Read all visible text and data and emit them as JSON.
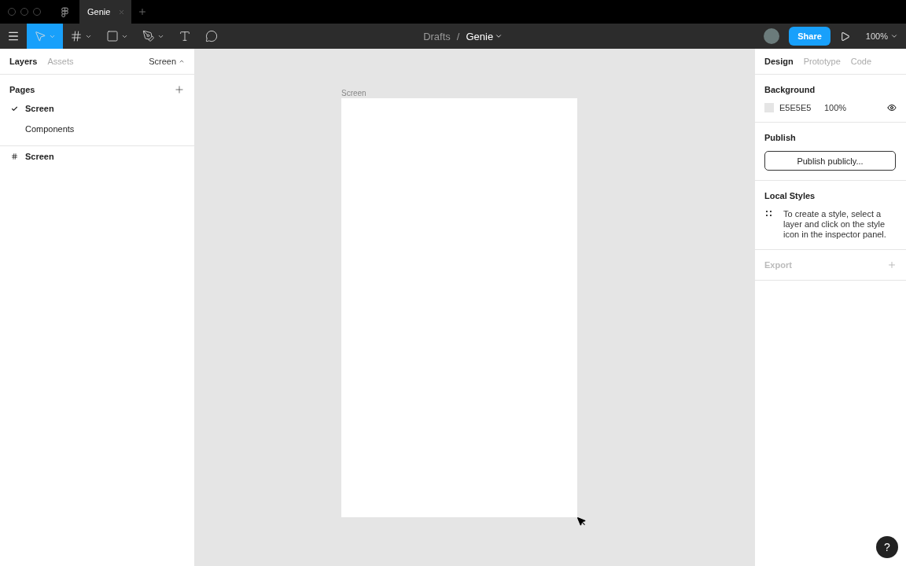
{
  "window": {
    "tabs": [
      {
        "label": "Genie",
        "selected": true
      }
    ]
  },
  "toolbar": {
    "tools": [
      {
        "kind": "move",
        "selected": true,
        "dropdown": true
      },
      {
        "kind": "frame",
        "selected": false,
        "dropdown": true
      },
      {
        "kind": "shape",
        "selected": false,
        "dropdown": true
      },
      {
        "kind": "pen",
        "selected": false,
        "dropdown": true
      },
      {
        "kind": "text",
        "selected": false,
        "dropdown": false
      },
      {
        "kind": "comment",
        "selected": false,
        "dropdown": false
      }
    ],
    "breadcrumb": {
      "folder": "Drafts",
      "separator": "/",
      "file": "Genie"
    },
    "share": "Share",
    "zoom": "100%"
  },
  "left_panel": {
    "tabs": [
      {
        "label": "Layers",
        "selected": true
      },
      {
        "label": "Assets",
        "selected": false
      }
    ],
    "page_selector": "Screen",
    "pages_title": "Pages",
    "pages": [
      {
        "label": "Screen",
        "selected": true
      },
      {
        "label": "Components",
        "selected": false
      }
    ],
    "layers": [
      {
        "label": "Screen"
      }
    ]
  },
  "canvas": {
    "frame_label": "Screen"
  },
  "right_panel": {
    "tabs": [
      {
        "label": "Design",
        "selected": true
      },
      {
        "label": "Prototype",
        "selected": false
      },
      {
        "label": "Code",
        "selected": false
      }
    ],
    "background": {
      "title": "Background",
      "hex": "E5E5E5",
      "opacity": "100%"
    },
    "publish": {
      "title": "Publish",
      "button": "Publish publicly..."
    },
    "local_styles": {
      "title": "Local Styles",
      "hint": "To create a style, select a layer and click on the style icon in the inspector panel."
    },
    "export": {
      "title": "Export"
    }
  },
  "help": "?"
}
